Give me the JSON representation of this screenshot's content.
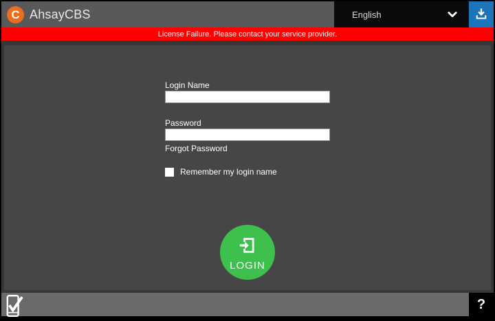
{
  "header": {
    "app_title": "AhsayCBS",
    "logo_letter": "C",
    "language_selected": "English"
  },
  "banner": {
    "message": "License Failure. Please contact your service provider."
  },
  "form": {
    "login_name_label": "Login Name",
    "login_name_value": "",
    "password_label": "Password",
    "password_value": "",
    "forgot_password_label": "Forgot Password",
    "remember_label": "Remember my login name",
    "remember_checked": false,
    "login_button_label": "LOGIN"
  },
  "footer": {
    "help_label": "?"
  },
  "icons": {
    "logo": "ahsay-logo",
    "language_chevron": "chevron-down-icon",
    "download": "download-icon",
    "login_arrow": "login-enter-icon",
    "mobile_check": "mobile-check-icon",
    "help": "question-mark"
  },
  "colors": {
    "brand_orange": "#ed6d1f",
    "banner_red": "#fe0000",
    "login_green": "#3ec04d",
    "download_blue": "#1b75bb",
    "header_gray": "#58595b",
    "panel_gray": "#464646",
    "footer_gray": "#6a6a6a"
  }
}
